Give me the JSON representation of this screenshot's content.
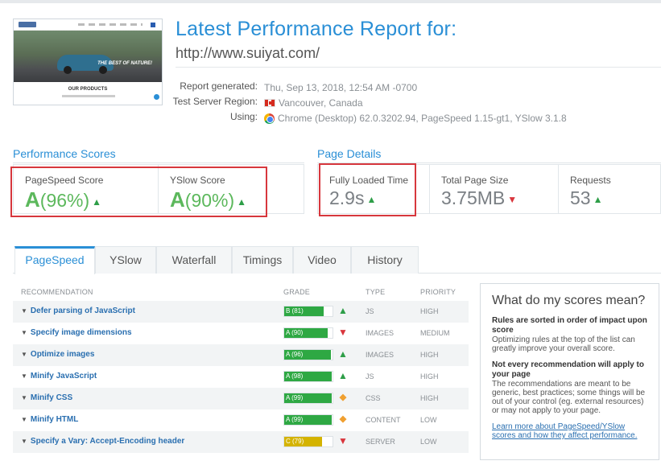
{
  "report": {
    "title": "Latest Performance Report for:",
    "url": "http://www.suiyat.com/",
    "thumbnail": {
      "products_heading": "OUR PRODUCTS",
      "hero_caption": "THE BEST OF NATURE!"
    },
    "meta": [
      {
        "key": "Report generated:",
        "value": "Thu, Sep 13, 2018, 12:54 AM -0700",
        "icon": ""
      },
      {
        "key": "Test Server Region:",
        "value": "Vancouver, Canada",
        "icon": "canada-flag-icon"
      },
      {
        "key": "Using:",
        "value": "Chrome (Desktop) 62.0.3202.94, PageSpeed 1.15-gt1, YSlow 3.1.8",
        "icon": "chrome-icon"
      }
    ]
  },
  "performance": {
    "label": "Performance Scores",
    "pagespeed": {
      "label": "PageSpeed Score",
      "grade": "A",
      "pct": "(96%)",
      "trend": "up"
    },
    "yslow": {
      "label": "YSlow Score",
      "grade": "A",
      "pct": "(90%)",
      "trend": "up"
    }
  },
  "details": {
    "label": "Page Details",
    "fully_loaded": {
      "label": "Fully Loaded Time",
      "value": "2.9s",
      "trend": "up"
    },
    "page_size": {
      "label": "Total Page Size",
      "value": "3.75MB",
      "trend": "down"
    },
    "requests": {
      "label": "Requests",
      "value": "53",
      "trend": "up"
    }
  },
  "tabs": [
    "PageSpeed",
    "YSlow",
    "Waterfall",
    "Timings",
    "Video",
    "History"
  ],
  "table": {
    "headers": {
      "recommendation": "RECOMMENDATION",
      "grade": "GRADE",
      "type": "TYPE",
      "priority": "PRIORITY"
    },
    "rows": [
      {
        "label": "Defer parsing of JavaScript",
        "grade": "B (81)",
        "score": 81,
        "color": "#2ea843",
        "icon": "up",
        "type": "JS",
        "priority": "HIGH"
      },
      {
        "label": "Specify image dimensions",
        "grade": "A (90)",
        "score": 90,
        "color": "#2ea843",
        "icon": "down",
        "type": "IMAGES",
        "priority": "MEDIUM"
      },
      {
        "label": "Optimize images",
        "grade": "A (96)",
        "score": 96,
        "color": "#2ea843",
        "icon": "up",
        "type": "IMAGES",
        "priority": "HIGH"
      },
      {
        "label": "Minify JavaScript",
        "grade": "A (98)",
        "score": 98,
        "color": "#2ea843",
        "icon": "up",
        "type": "JS",
        "priority": "HIGH"
      },
      {
        "label": "Minify CSS",
        "grade": "A (99)",
        "score": 99,
        "color": "#2ea843",
        "icon": "diamond",
        "type": "CSS",
        "priority": "HIGH"
      },
      {
        "label": "Minify HTML",
        "grade": "A (99)",
        "score": 99,
        "color": "#2ea843",
        "icon": "diamond",
        "type": "CONTENT",
        "priority": "LOW"
      },
      {
        "label": "Specify a Vary: Accept-Encoding header",
        "grade": "C (79)",
        "score": 79,
        "color": "#d4b300",
        "icon": "down",
        "type": "SERVER",
        "priority": "LOW"
      }
    ]
  },
  "side": {
    "title": "What do my scores mean?",
    "h1": "Rules are sorted in order of impact upon score",
    "p1": "Optimizing rules at the top of the list can greatly improve your overall score.",
    "h2": "Not every recommendation will apply to your page",
    "p2": "The recommendations are meant to be generic, best practices; some things will be out of your control (eg. external resources) or may not apply to your page.",
    "link": "Learn more about PageSpeed/YSlow scores and how they affect performance."
  }
}
